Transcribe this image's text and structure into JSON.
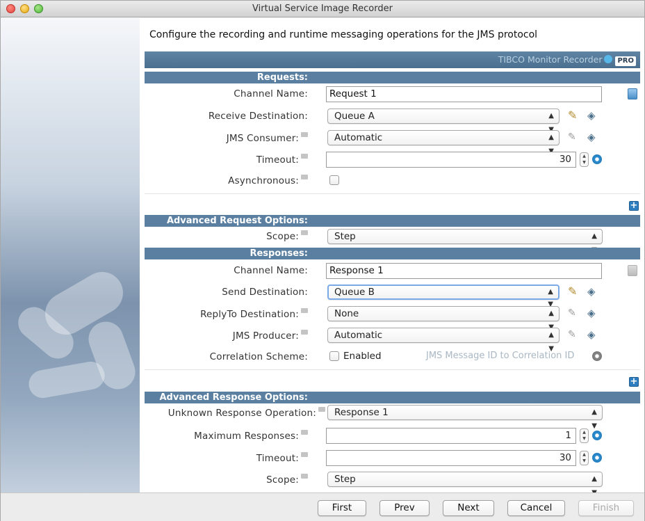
{
  "window": {
    "title": "Virtual Service Image Recorder"
  },
  "intro": "Configure the recording and runtime messaging operations for the JMS protocol",
  "banner": {
    "text": "TIBCO Monitor Recorder",
    "badge": "PRO"
  },
  "requests": {
    "heading": "Requests:",
    "channel_name_label": "Channel Name:",
    "channel_name_value": "Request 1",
    "receive_destination_label": "Receive Destination:",
    "receive_destination_value": "Queue A",
    "jms_consumer_label": "JMS Consumer:",
    "jms_consumer_value": "Automatic",
    "timeout_label": "Timeout:",
    "timeout_value": "30",
    "asynchronous_label": "Asynchronous:"
  },
  "advanced_request": {
    "heading": "Advanced Request Options:",
    "scope_label": "Scope:",
    "scope_value": "Step"
  },
  "responses": {
    "heading": "Responses:",
    "channel_name_label": "Channel Name:",
    "channel_name_value": "Response 1",
    "send_destination_label": "Send Destination:",
    "send_destination_value": "Queue B",
    "replyto_label": "ReplyTo Destination:",
    "replyto_value": "None",
    "jms_producer_label": "JMS Producer:",
    "jms_producer_value": "Automatic",
    "correlation_label": "Correlation Scheme:",
    "correlation_enabled_label": "Enabled",
    "correlation_hint": "JMS Message ID to Correlation ID"
  },
  "advanced_response": {
    "heading": "Advanced Response Options:",
    "unknown_op_label": "Unknown Response Operation:",
    "unknown_op_value": "Response 1",
    "max_responses_label": "Maximum Responses:",
    "max_responses_value": "1",
    "timeout_label": "Timeout:",
    "timeout_value": "30",
    "scope_label": "Scope:",
    "scope_value": "Step"
  },
  "buttons": {
    "first": "First",
    "prev": "Prev",
    "next": "Next",
    "cancel": "Cancel",
    "finish": "Finish"
  },
  "colors": {
    "section_header": "#5a7fa0",
    "banner": "#4b6f8f",
    "accent": "#2f8fd0"
  }
}
